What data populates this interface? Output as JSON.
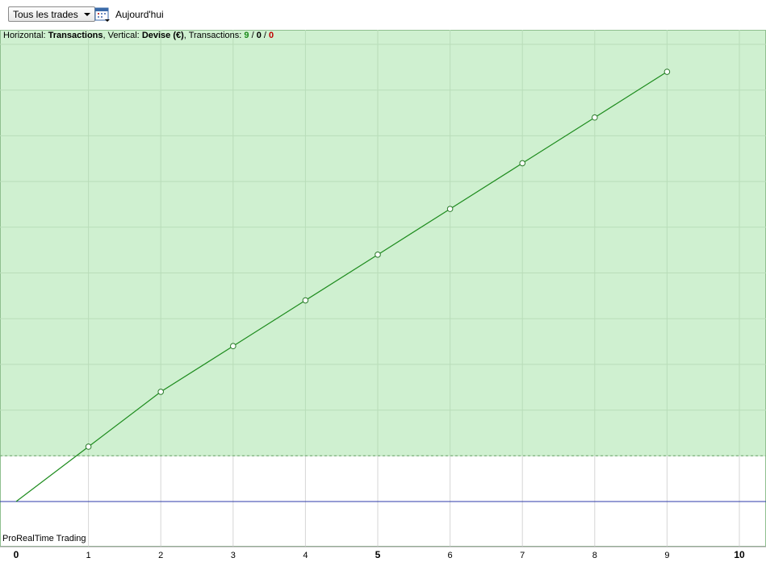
{
  "toolbar": {
    "filter_select": "Tous les trades",
    "date_button": "Aujourd'hui",
    "calendar_icon": "calendar-icon"
  },
  "header": {
    "horizontal_label": "Horizontal:",
    "horizontal_value": "Transactions",
    "vertical_label": ", Vertical:",
    "vertical_value": "Devise (€)",
    "transactions_label": ", Transactions:",
    "count_winning": "9",
    "sep1": " / ",
    "count_neutral": "0",
    "sep2": " / ",
    "count_losing": "0"
  },
  "branding": "ProRealTime Trading",
  "colors": {
    "profit_zone": "#cff0d0",
    "line": "#1e8c1e",
    "zero_line": "#2c3aa8",
    "grid": "#b9ddb9",
    "winning": "#1a8a1a",
    "losing": "#c00000"
  },
  "chart_data": {
    "type": "line",
    "xlabel": "Transactions",
    "ylabel": "Devise (€)",
    "x": [
      0,
      1,
      2,
      3,
      4,
      5,
      6,
      7,
      8,
      9
    ],
    "values": [
      0,
      1.2,
      2.4,
      3.4,
      4.4,
      5.4,
      6.4,
      7.4,
      8.4,
      9.4
    ],
    "x_ticks": [
      "0",
      "1",
      "2",
      "3",
      "4",
      "5",
      "6",
      "7",
      "8",
      "9",
      "10"
    ],
    "xlim": [
      0,
      10
    ],
    "ylim": [
      -1,
      10.5
    ],
    "grid": true,
    "markers": "hollow-circle"
  }
}
